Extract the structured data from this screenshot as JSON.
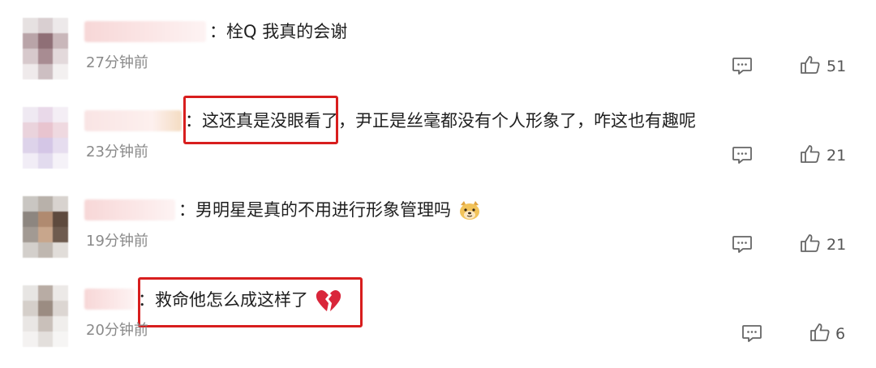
{
  "comments": [
    {
      "text": "：栓Q 我真的会谢",
      "time": "27分钟前",
      "likes": "51",
      "reply_icon": "comment-bubble-icon",
      "like_icon": "thumbs-up-icon"
    },
    {
      "text": "：这还真是没眼看了，尹正是丝毫都没有个人形象了，咋这也有趣呢",
      "time": "23分钟前",
      "likes": "21",
      "reply_icon": "comment-bubble-icon",
      "like_icon": "thumbs-up-icon"
    },
    {
      "text": "：男明星是真的不用进行形象管理吗",
      "emoji": "dog-face-emoji-icon",
      "time": "19分钟前",
      "likes": "21",
      "reply_icon": "comment-bubble-icon",
      "like_icon": "thumbs-up-icon"
    },
    {
      "text": "：救命他怎么成这样了",
      "emoji": "broken-heart-icon",
      "time": "20分钟前",
      "likes": "6",
      "reply_icon": "comment-bubble-icon",
      "like_icon": "thumbs-up-icon"
    }
  ],
  "colors": {
    "highlight": "#d81e1e",
    "timestamp": "#8a8a8a",
    "text": "#1f1f1f",
    "icon": "#666666"
  }
}
